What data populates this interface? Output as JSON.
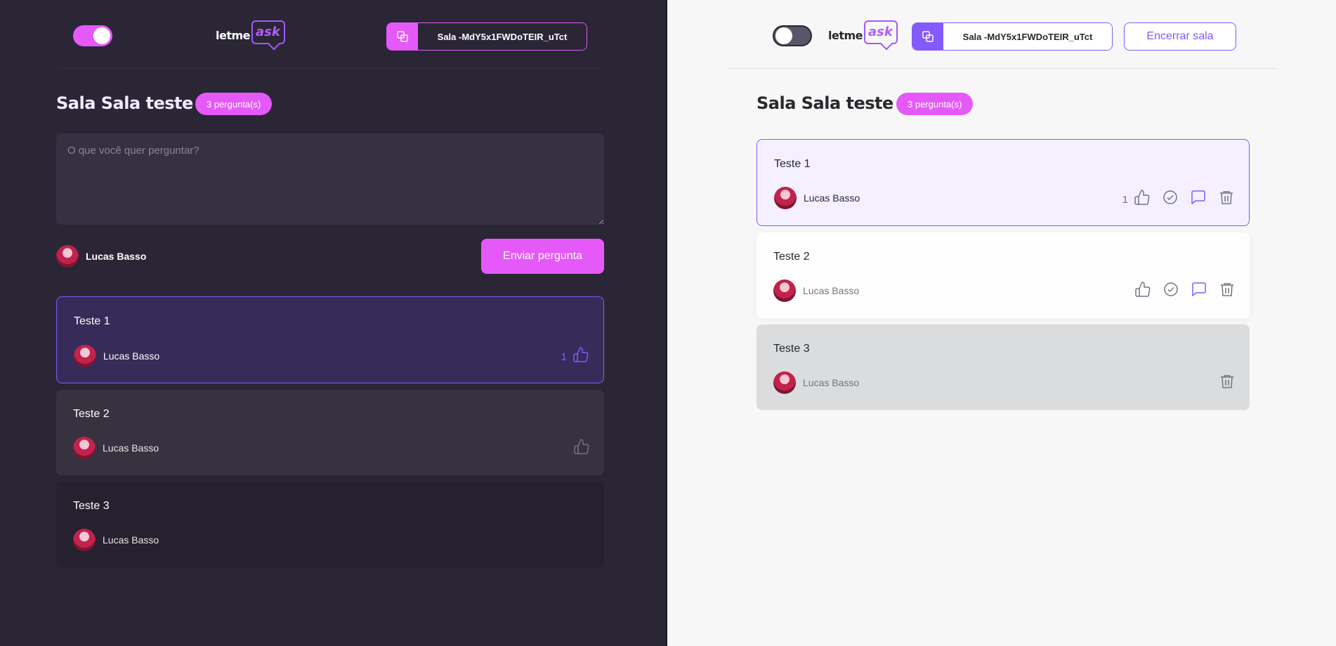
{
  "left": {
    "theme_toggle": {
      "state": "on"
    },
    "logo": {
      "text1": "letme",
      "text2": "ask"
    },
    "room_code": {
      "label": "Sala -MdY5x1FWDoTEIR_uTct"
    },
    "room_title": "Sala Sala teste",
    "question_count": "3 pergunta(s)",
    "textarea_placeholder": "O que você quer perguntar?",
    "user_name": "Lucas Basso",
    "send_button": "Enviar pergunta",
    "questions": [
      {
        "content": "Teste 1",
        "author": "Lucas Basso",
        "likes": "1",
        "state": "highlighted"
      },
      {
        "content": "Teste 2",
        "author": "Lucas Basso",
        "likes": "",
        "state": "normal"
      },
      {
        "content": "Teste 3",
        "author": "Lucas Basso",
        "likes": "",
        "state": "answered"
      }
    ]
  },
  "right": {
    "theme_toggle": {
      "state": "off"
    },
    "logo": {
      "text1": "letme",
      "text2": "ask"
    },
    "room_code": {
      "label": "Sala -MdY5x1FWDoTEIR_uTct"
    },
    "close_room_button": "Encerrar sala",
    "room_title": "Sala Sala teste",
    "question_count": "3 pergunta(s)",
    "questions": [
      {
        "content": "Teste 1",
        "author": "Lucas Basso",
        "likes": "1",
        "state": "highlighted"
      },
      {
        "content": "Teste 2",
        "author": "Lucas Basso",
        "likes": "",
        "state": "normal"
      },
      {
        "content": "Teste 3",
        "author": "Lucas Basso",
        "likes": "",
        "state": "answered"
      }
    ]
  },
  "colors": {
    "accent_pink": "#e559f9",
    "accent_purple": "#835afd",
    "dark_bg": "#2a2636",
    "light_bg": "#f7f7f7"
  }
}
